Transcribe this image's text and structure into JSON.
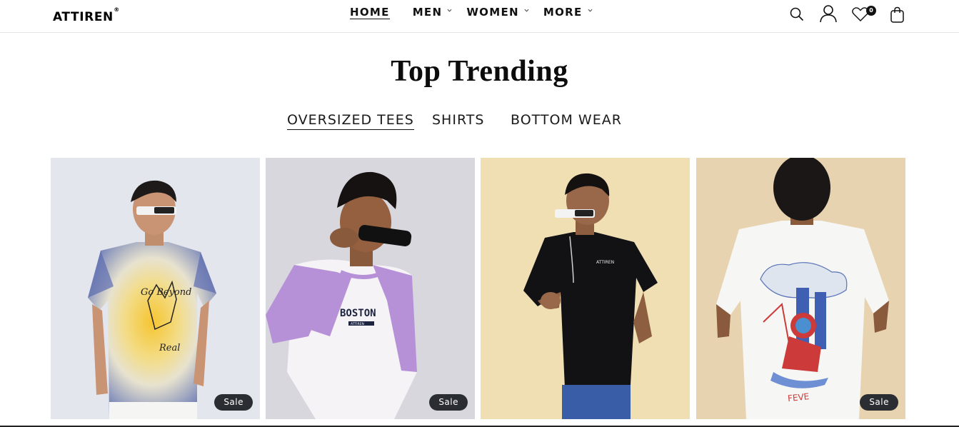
{
  "brand": {
    "name": "ATTIREN",
    "reg_mark": "®"
  },
  "nav": [
    {
      "label": "HOME",
      "active": true,
      "has_dropdown": false
    },
    {
      "label": "MEN",
      "active": false,
      "has_dropdown": true
    },
    {
      "label": "WOMEN",
      "active": false,
      "has_dropdown": true
    },
    {
      "label": "MORE",
      "active": false,
      "has_dropdown": true
    }
  ],
  "header_icons": [
    "search-icon",
    "account-icon",
    "wishlist-icon",
    "cart-icon"
  ],
  "wishlist_count": "0",
  "section": {
    "title": "Top Trending",
    "tabs": [
      "OVERSIZED TEES",
      "SHIRTS",
      "BOTTOM WEAR"
    ],
    "active_tab": "OVERSIZED TEES"
  },
  "products": [
    {
      "print_text": "Go Beyond Real",
      "badge": "Sale",
      "bg": "#e4e6ee",
      "shirt": "tie-dye"
    },
    {
      "print_text": "BOSTON",
      "print_sub": "ATTIREN",
      "badge": "Sale",
      "bg": "#d9d7de",
      "shirt": "raglan-lilac"
    },
    {
      "print_text": "ATTIREN",
      "badge": "",
      "bg": "#f1dfb4",
      "shirt": "black"
    },
    {
      "print_text": "",
      "badge": "Sale",
      "bg": "#e8d3b0",
      "shirt": "white-graphic"
    }
  ],
  "colors": {
    "text": "#111111",
    "badge_bg": "#2a2d31",
    "divider": "#e6e6e6"
  }
}
